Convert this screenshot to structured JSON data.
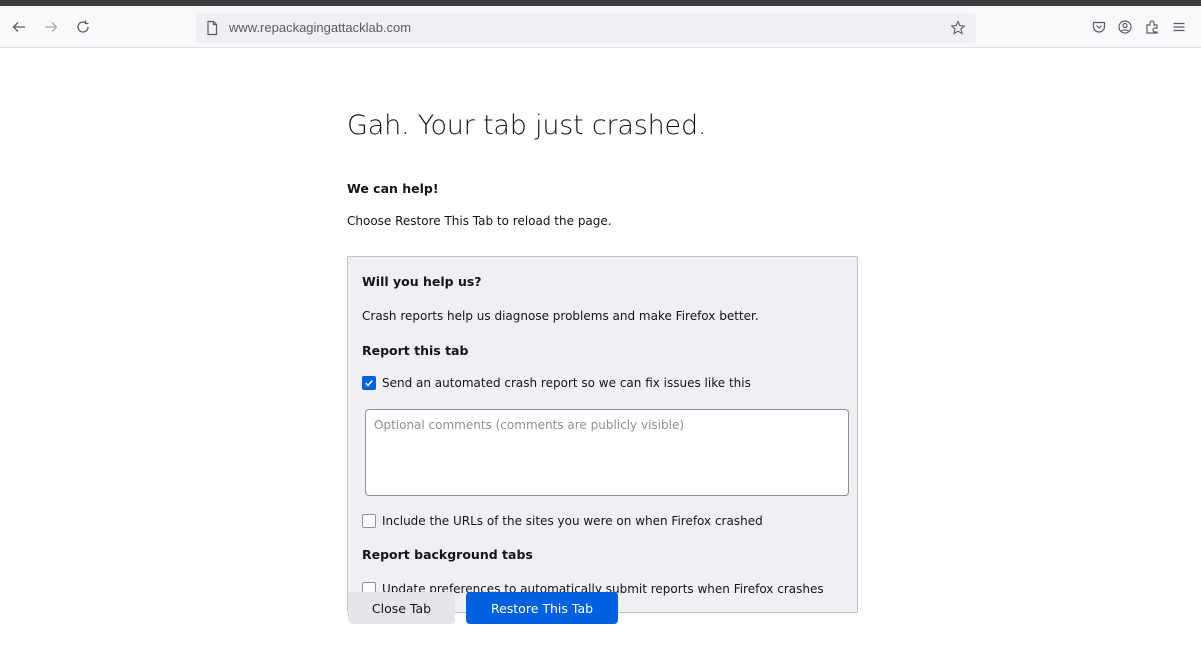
{
  "browser": {
    "url": "www.repackagingattacklab.com",
    "icons": {
      "back": "back-arrow-icon",
      "forward": "forward-arrow-icon",
      "reload": "reload-icon",
      "page": "page-icon",
      "bookmark": "bookmark-star-icon",
      "pocket": "pocket-icon",
      "account": "account-icon",
      "extensions": "extensions-icon",
      "menu": "hamburger-menu-icon"
    }
  },
  "crash_page": {
    "title": "Gah. Your tab just crashed.",
    "help_heading": "We can help!",
    "help_text": "Choose Restore This Tab to reload the page.",
    "panel": {
      "heading": "Will you help us?",
      "text": "Crash reports help us diagnose problems and make Firefox better.",
      "report_tab_heading": "Report this tab",
      "send_report_label": "Send an automated crash report so we can fix issues like this",
      "send_report_checked": true,
      "comments_placeholder": "Optional comments (comments are publicly visible)",
      "comments_value": "",
      "include_urls_label": "Include the URLs of the sites you were on when Firefox crashed",
      "include_urls_checked": false,
      "background_heading": "Report background tabs",
      "auto_submit_label": "Update preferences to automatically submit reports when Firefox crashes",
      "auto_submit_checked": false
    },
    "buttons": {
      "close_label": "Close Tab",
      "restore_label": "Restore This Tab"
    }
  },
  "colors": {
    "accent": "#0061e0",
    "panel_bg": "#f0f0f4",
    "text": "#15141a"
  }
}
